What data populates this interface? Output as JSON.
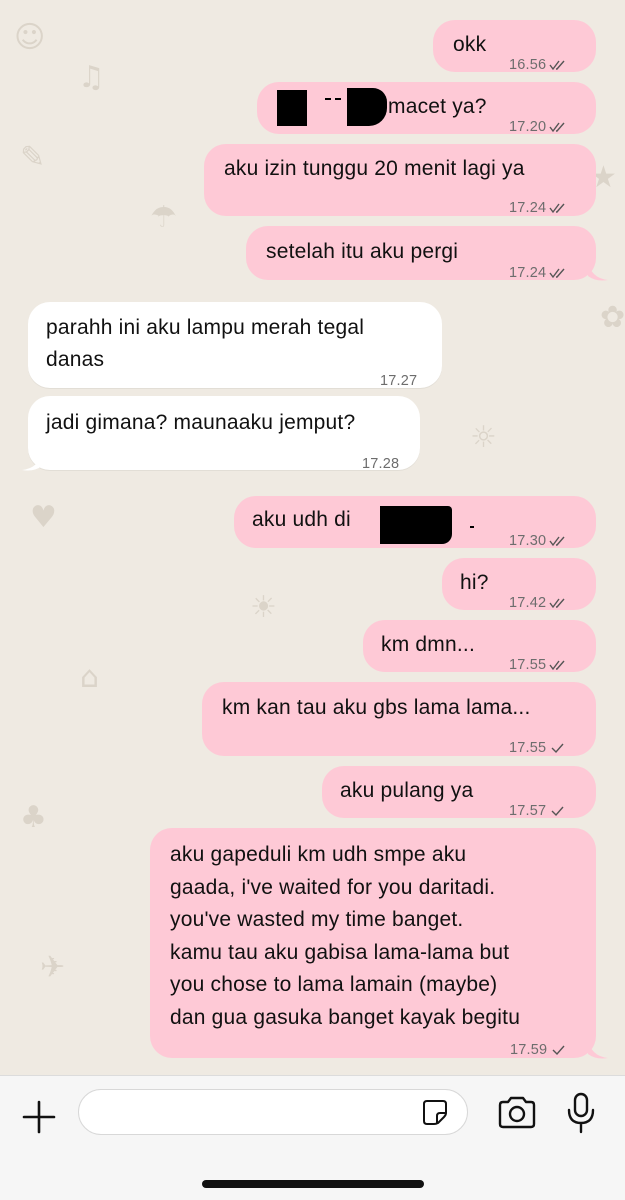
{
  "messages": [
    {
      "text": "okk",
      "time": "16.56",
      "dir": "out",
      "status": "read"
    },
    {
      "text": "macet ya?",
      "time": "17.20",
      "dir": "out",
      "status": "read"
    },
    {
      "text": "aku izin tunggu 20 menit lagi ya",
      "time": "17.24",
      "dir": "out",
      "status": "read"
    },
    {
      "text": "setelah itu aku pergi",
      "time": "17.24",
      "dir": "out",
      "status": "read"
    },
    {
      "text": "parahh ini aku lampu merah tegal\ndanas",
      "time": "17.27",
      "dir": "in"
    },
    {
      "text": "jadi gimana? maunaaku jemput?",
      "time": "17.28",
      "dir": "in"
    },
    {
      "text": "aku udh di",
      "time": "17.30",
      "dir": "out",
      "status": "read"
    },
    {
      "text": "hi?",
      "time": "17.42",
      "dir": "out",
      "status": "read"
    },
    {
      "text": "km dmn...",
      "time": "17.55",
      "dir": "out",
      "status": "read"
    },
    {
      "text": "km kan tau aku gbs lama lama...",
      "time": "17.55",
      "dir": "out",
      "status": "sent"
    },
    {
      "text": "aku pulang ya",
      "time": "17.57",
      "dir": "out",
      "status": "sent"
    },
    {
      "text": "aku gapeduli km udh smpe aku\ngaada, i've waited for you daritadi.\nyou've wasted my time banget.\nkamu tau aku gabisa lama-lama but\nyou chose to lama lamain (maybe)\ndan gua gasuka banget kayak begitu",
      "time": "17.59",
      "dir": "out",
      "status": "sent"
    }
  ],
  "input_bar": {
    "message_value": "",
    "icons": [
      "plus-icon",
      "sticker-icon",
      "camera-icon",
      "microphone-icon"
    ]
  },
  "colors": {
    "outgoing_bubble": "#fec9d6",
    "incoming_bubble": "#ffffff",
    "chat_background": "#efeae2",
    "input_bar": "#f6f6f6",
    "read_ticks": "#555555"
  }
}
